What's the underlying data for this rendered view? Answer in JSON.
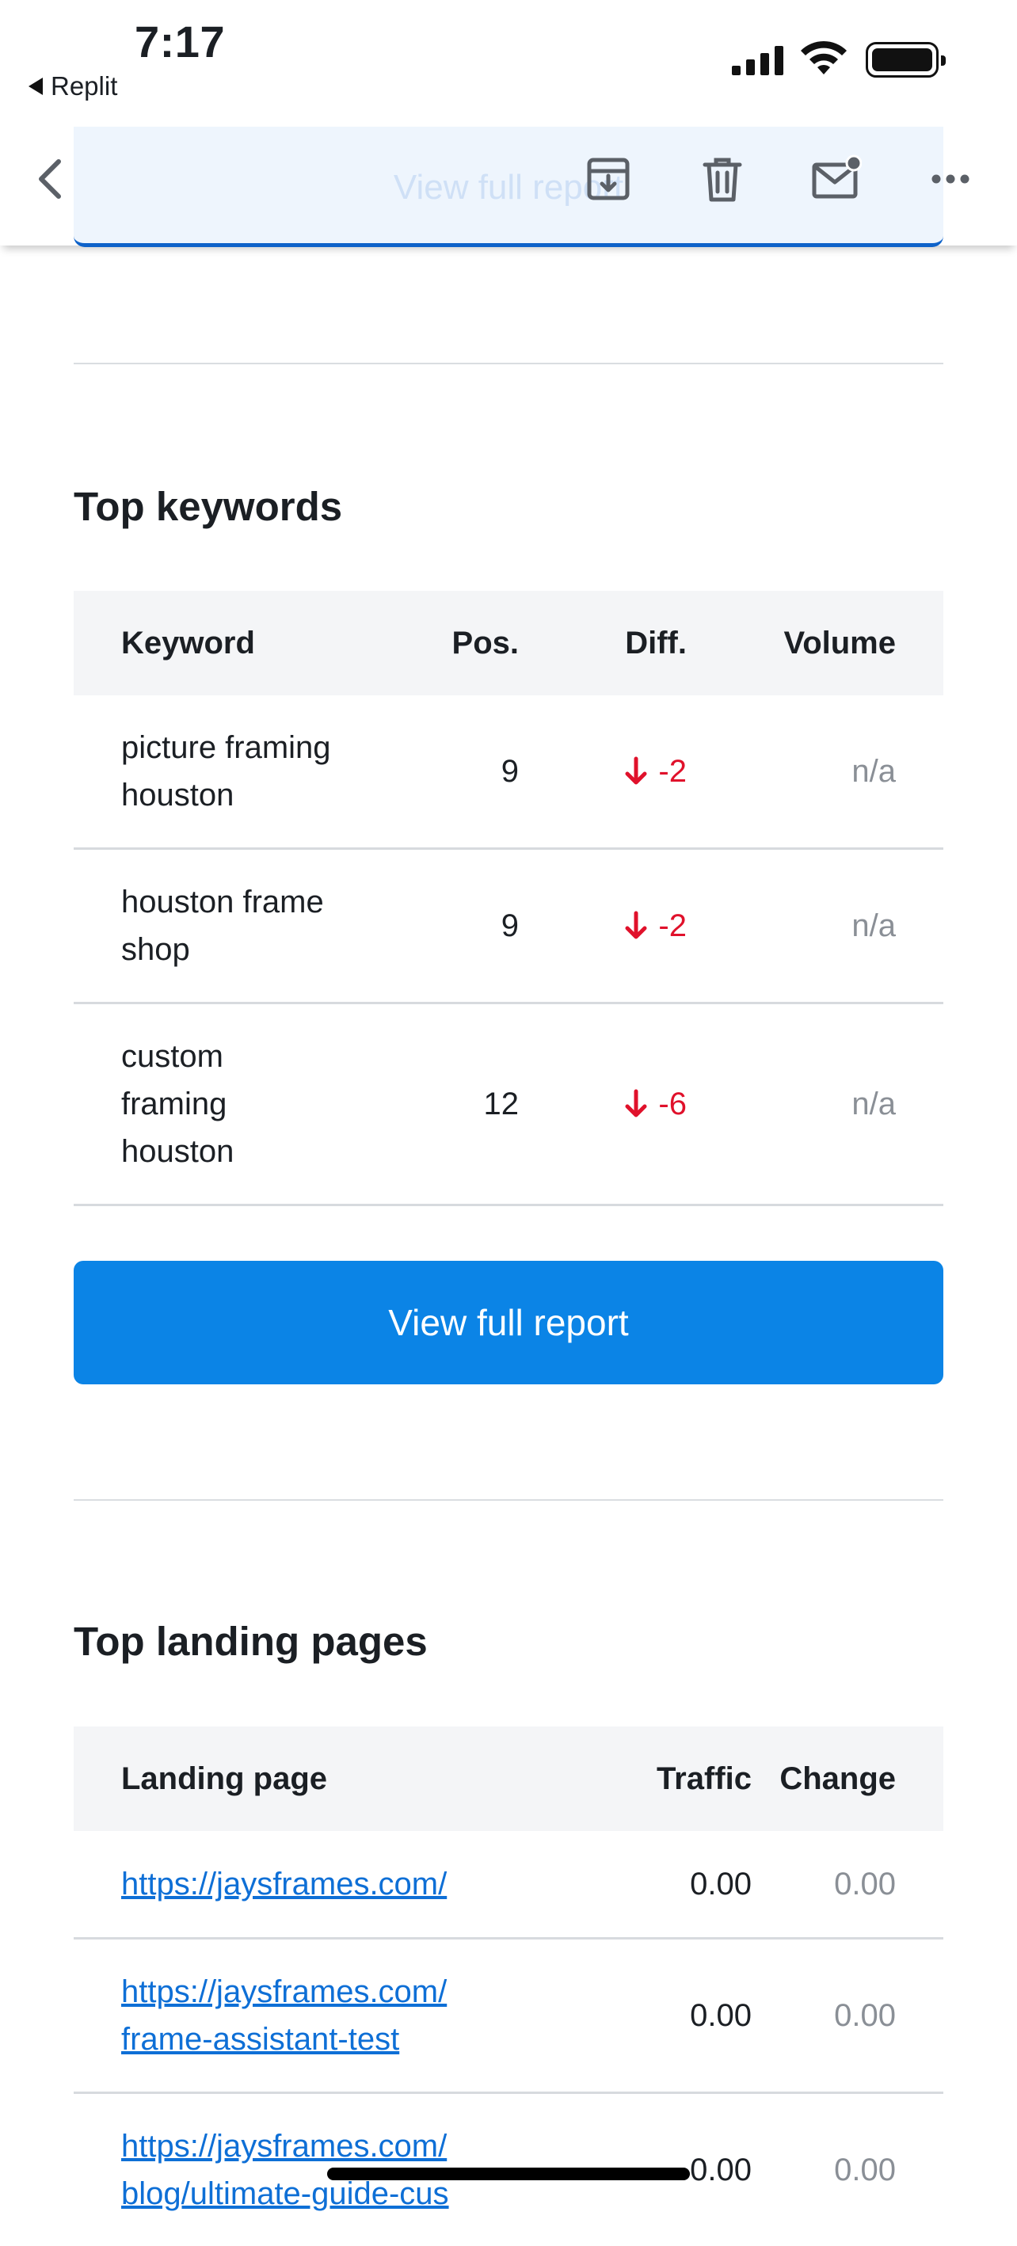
{
  "status_bar": {
    "time": "7:17",
    "back_app_label": "Replit"
  },
  "toolbar": {
    "faded_button_label": "View full report",
    "icons": [
      "chevron-left-icon",
      "archive-icon",
      "trash-icon",
      "mail-unread-icon",
      "more-icon"
    ]
  },
  "keywords_section": {
    "title": "Top keywords",
    "headers": {
      "keyword": "Keyword",
      "pos": "Pos.",
      "diff": "Diff.",
      "volume": "Volume"
    },
    "rows": [
      {
        "keyword_line1": "picture framing",
        "keyword_line2": "houston",
        "keyword_line3": "",
        "pos": "9",
        "diff": "-2",
        "volume": "n/a"
      },
      {
        "keyword_line1": "houston frame",
        "keyword_line2": "shop",
        "keyword_line3": "",
        "pos": "9",
        "diff": "-2",
        "volume": "n/a"
      },
      {
        "keyword_line1": "custom",
        "keyword_line2": "framing",
        "keyword_line3": "houston",
        "pos": "12",
        "diff": "-6",
        "volume": "n/a"
      }
    ],
    "cta_label": "View full report"
  },
  "landing_section": {
    "title": "Top landing pages",
    "headers": {
      "landing_page": "Landing page",
      "traffic": "Traffic",
      "change": "Change"
    },
    "rows": [
      {
        "url_line1": "https://jaysframes.com/",
        "url_line2": "",
        "traffic": "0.00",
        "change": "0.00"
      },
      {
        "url_line1": "https://jaysframes.com/",
        "url_line2": "frame-assistant-test",
        "traffic": "0.00",
        "change": "0.00"
      },
      {
        "url_line1": "https://jaysframes.com/",
        "url_line2": "blog/ultimate-guide-cus",
        "traffic": "0.00",
        "change": "0.00"
      }
    ]
  },
  "colors": {
    "accent_blue": "#0b84e6",
    "link_blue": "#0e6fd6",
    "negative_red": "#e0112b",
    "muted_gray": "#8a8f96"
  }
}
